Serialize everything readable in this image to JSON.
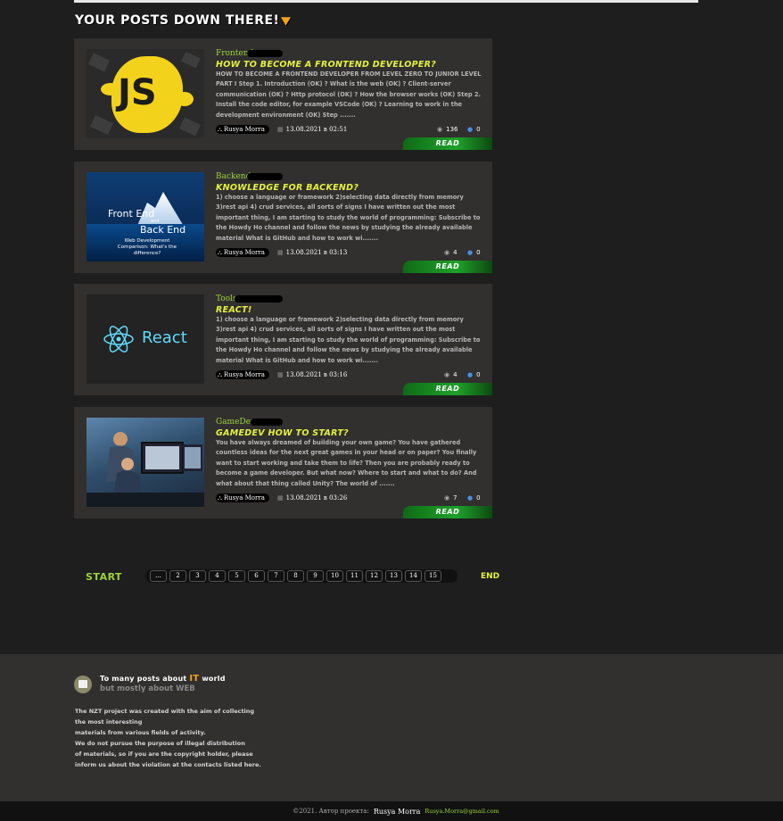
{
  "section_title": "Your posts down there!",
  "posts": [
    {
      "tag": "Frontend",
      "title": "How to become a frontend developer?",
      "excerpt": "HOW TO BECOME A FRONTEND DEVELOPER FROM LEVEL ZERO TO JUNIOR LEVEL PART I Step 1. Introduction (OK) ? What is the web (OK) ? Client-server communication (OK) ? Http protocol (OK) ? How the browser works (OK) Step 2. Install the code editor, for example VSCode (OK) ? Learning to work in the development environment (OK) Step .......",
      "author": "Rusya Morra",
      "date": "13.08.2021 в 02:51",
      "views": "136",
      "comments": "0",
      "read": "Read",
      "thumb_text": "JS"
    },
    {
      "tag": "Backend",
      "title": "Knowledge for backend?",
      "excerpt": "1) choose a language or framework 2)selecting data directly from memory 3)rest api 4) crud services, all sorts of signs I have written out the most important thing, I am starting to study the world of programming: Subscribe to the Howdy Ho channel and follow the news by studying the already available material What is GitHub and how to work wi.......",
      "author": "Rusya Morra",
      "date": "13.08.2021 в 03:13",
      "views": "4",
      "comments": "0",
      "read": "Read",
      "thumb_text": {
        "fe": "Front End",
        "and": "and",
        "be": "Back End",
        "sub": "Web Development Comparison: What's the difference?"
      }
    },
    {
      "tag": "Tools",
      "title": "React!",
      "excerpt": "1) choose a language or framework 2)selecting data directly from memory 3)rest api 4) crud services, all sorts of signs I have written out the most important thing, I am starting to study the world of programming: Subscribe to the Howdy Ho channel and follow the news by studying the already available material What is GitHub and how to work wi.......",
      "author": "Rusya Morra",
      "date": "13.08.2021 в 03:16",
      "views": "4",
      "comments": "0",
      "read": "Read",
      "thumb_text": "React"
    },
    {
      "tag": "GameDev",
      "title": "GameDev how to start?",
      "excerpt": "You have always dreamed of building your own game? You have gathered countless ideas for the next great games in your head or on paper? You finally want to start working and take them to life? Then you are probably ready to become a game developer. But what now? Where to start and what to do? And what about that thing called Unity? The world of .......",
      "author": "Rusya Morra",
      "date": "13.08.2021 в 03:26",
      "views": "7",
      "comments": "0",
      "read": "Read"
    }
  ],
  "pagination": {
    "start": "START",
    "end": "END",
    "pages": [
      "...",
      "2",
      "3",
      "4",
      "5",
      "6",
      "7",
      "8",
      "9",
      "10",
      "11",
      "12",
      "13",
      "14",
      "15"
    ]
  },
  "footer": {
    "title_pre": "To many posts about ",
    "title_it": "IT",
    "title_post": " world",
    "subtitle": "but mostly about WEB",
    "lines": [
      "The NZT project was created with the aim of collecting",
      "the most interesting",
      "materials from various fields of activity.",
      "We do not pursue the purpose of illegal distribution",
      "of materials, so if you are the copyright holder, please",
      "inform us about the violation at the contacts listed here."
    ]
  },
  "bottom": {
    "copyright": "©2021. Автор проекта:",
    "author": "Rusya Morra",
    "email": "Rusya.Morra@gmail.com"
  },
  "colors": {
    "accent_green": "#9bd43a",
    "title_yellow": "#e4f23a",
    "orange": "#f2a51a",
    "card_bg": "#322f2f",
    "page_bg": "#1e1e1e"
  }
}
